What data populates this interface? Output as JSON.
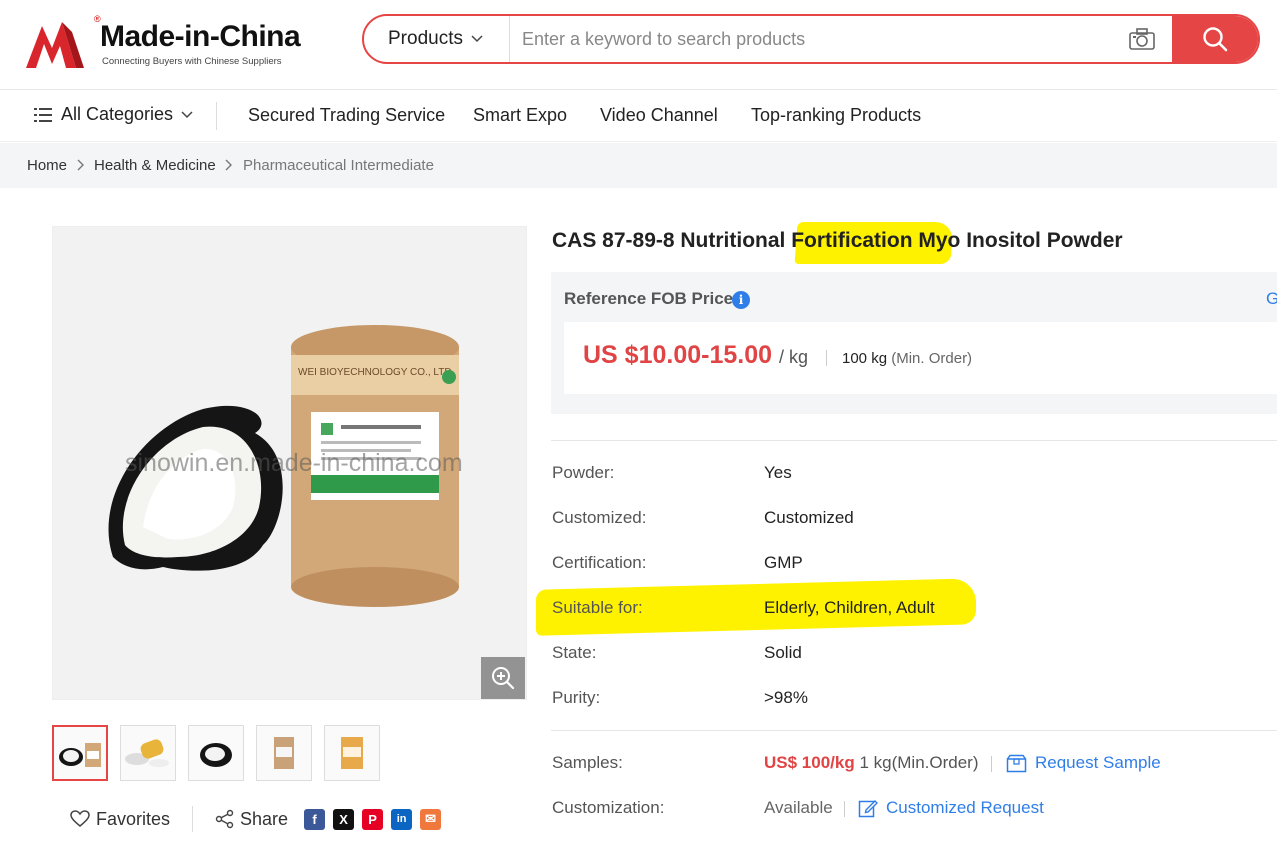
{
  "header": {
    "logo_name": "Made-in-China",
    "logo_tagline": "Connecting Buyers with Chinese Suppliers",
    "search_category": "Products",
    "search_placeholder": "Enter a keyword to search products"
  },
  "nav": {
    "all_categories": "All Categories",
    "links": [
      "Secured Trading Service",
      "Smart Expo",
      "Video Channel",
      "Top-ranking Products"
    ]
  },
  "breadcrumb": [
    "Home",
    "Health & Medicine",
    "Pharmaceutical Intermediate"
  ],
  "gallery": {
    "watermark": "sinowin.en.made-in-china.com",
    "thumbnail_count": 5
  },
  "product": {
    "title": "CAS 87-89-8 Nutritional Fortification Myo Inositol Powder",
    "ref_label": "Reference FOB Price",
    "ref_cut_text": "G",
    "price": "US $10.00-15.00",
    "unit": "/ kg",
    "moq": "100 kg",
    "moq_note": "(Min. Order)",
    "attributes": [
      {
        "label": "Powder:",
        "value": "Yes"
      },
      {
        "label": "Customized:",
        "value": "Customized"
      },
      {
        "label": "Certification:",
        "value": "GMP"
      },
      {
        "label": "Suitable for:",
        "value": "Elderly, Children, Adult"
      },
      {
        "label": "State:",
        "value": "Solid"
      },
      {
        "label": "Purity:",
        "value": ">98%"
      }
    ],
    "samples_label": "Samples:",
    "samples_price": "US$ 100/kg",
    "samples_moq": "1 kg(Min.Order)",
    "request_sample": "Request Sample",
    "customization_label": "Customization:",
    "customization_value": "Available",
    "customized_request": "Customized Request"
  },
  "actions": {
    "favorites": "Favorites",
    "share": "Share",
    "social": [
      {
        "name": "facebook",
        "glyph": "f",
        "color": "#3b5998"
      },
      {
        "name": "x",
        "glyph": "X",
        "color": "#111111"
      },
      {
        "name": "pinterest",
        "glyph": "P",
        "color": "#e60023"
      },
      {
        "name": "linkedin",
        "glyph": "in",
        "color": "#0a66c2"
      },
      {
        "name": "email",
        "glyph": "✉",
        "color": "#f0783c"
      }
    ]
  },
  "colors": {
    "brand_red": "#e64545",
    "link_blue": "#2f7ee8",
    "highlight_yellow": "#fff200"
  }
}
